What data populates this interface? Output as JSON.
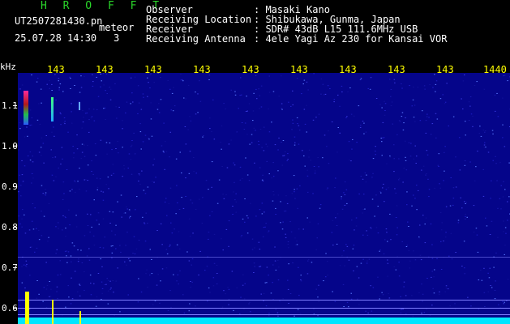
{
  "header": {
    "title": "H R O F F T",
    "filename": "UT2507281430.pn",
    "meteor_label": "meteor",
    "datetime": "25.07.28 14:30",
    "count": "3",
    "fields": [
      {
        "label": "Observer",
        "value": ": Masaki Kano"
      },
      {
        "label": "Receiving Location",
        "value": ": Shibukawa, Gunma, Japan"
      },
      {
        "label": "Receiver",
        "value": ": SDR# 43dB L15 111.6MHz USB"
      },
      {
        "label": "Receiving Antenna",
        "value": ": 4ele Yagi Az 230 for Kansai VOR"
      }
    ]
  },
  "axis": {
    "unit": "kHz",
    "time_ticks": [
      "143",
      "143",
      "143",
      "143",
      "143",
      "143",
      "143",
      "143",
      "143",
      "1440"
    ],
    "freq_ticks": [
      "1.1",
      "1.0",
      "0.9",
      "0.8",
      "0.7",
      "0.6"
    ]
  },
  "colors": {
    "background": "#000000",
    "plot": "#05058a",
    "title": "#2ad62a",
    "ticks": "#ffff00",
    "baseline": "#00ffff",
    "spike": "#ffff00"
  }
}
